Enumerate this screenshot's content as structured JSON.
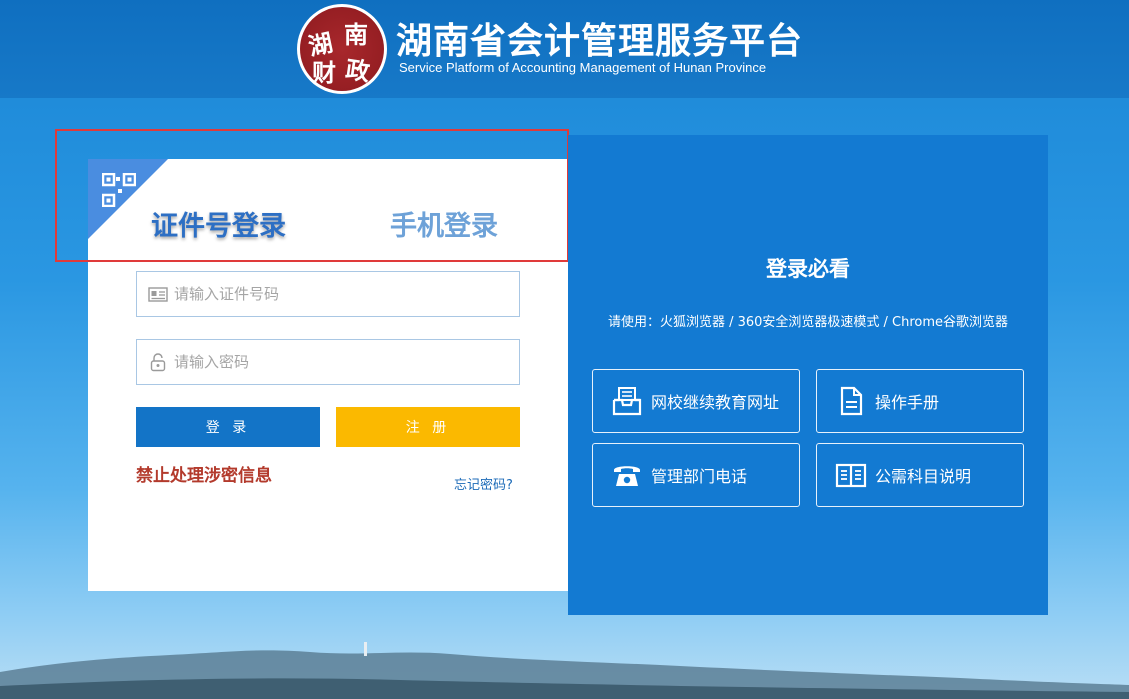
{
  "header": {
    "seal_chars": [
      "湖",
      "南",
      "财",
      "政"
    ],
    "title": "湖南省会计管理服务平台",
    "subtitle": "Service Platform of Accounting Management of Hunan Province"
  },
  "login": {
    "tab_cert": "证件号登录",
    "tab_phone": "手机登录",
    "id_placeholder": "请输入证件号码",
    "id_value": "",
    "password_placeholder": "请输入密码",
    "password_value": "",
    "login_label": "登 录",
    "register_label": "注 册",
    "warning": "禁止处理涉密信息",
    "forgot": "忘记密码?"
  },
  "info": {
    "title": "登录必看",
    "note": "请使用：火狐浏览器 / 360安全浏览器极速模式 / Chrome谷歌浏览器",
    "links": [
      {
        "label": "网校继续教育网址",
        "icon": "inbox-icon"
      },
      {
        "label": "操作手册",
        "icon": "document-icon"
      },
      {
        "label": "管理部门电话",
        "icon": "phone-icon"
      },
      {
        "label": "公需科目说明",
        "icon": "book-icon"
      }
    ]
  },
  "colors": {
    "header_blue": "#1779c8",
    "panel_blue": "#137ad2",
    "login_button": "#1374c7",
    "register_button": "#fbb900",
    "warning_text": "#b33a2c",
    "seal_red": "#8e1a1f",
    "highlight_border": "#e03a3a"
  }
}
